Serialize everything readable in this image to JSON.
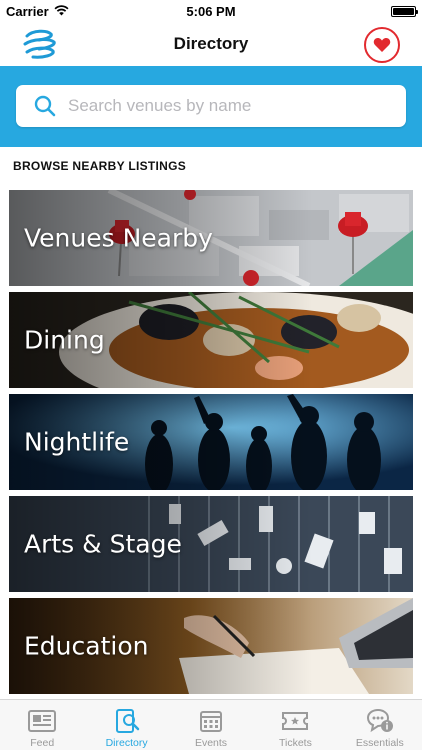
{
  "status_bar": {
    "carrier": "Carrier",
    "time": "5:06 PM",
    "battery_level": 1.0
  },
  "nav": {
    "title": "Directory",
    "logo_icon": "app-logo-icon",
    "favorite_icon": "heart-icon"
  },
  "search": {
    "placeholder": "Search venues by name",
    "value": ""
  },
  "section": {
    "title": "BROWSE NEARBY LISTINGS"
  },
  "tiles": [
    {
      "label": "Venues Nearby"
    },
    {
      "label": "Dining"
    },
    {
      "label": "Nightlife"
    },
    {
      "label": "Arts & Stage"
    },
    {
      "label": "Education"
    }
  ],
  "tabs": [
    {
      "label": "Feed",
      "icon": "newspaper-icon",
      "active": false
    },
    {
      "label": "Directory",
      "icon": "directory-icon",
      "active": true
    },
    {
      "label": "Events",
      "icon": "calendar-icon",
      "active": false
    },
    {
      "label": "Tickets",
      "icon": "ticket-icon",
      "active": false
    },
    {
      "label": "Essentials",
      "icon": "info-chat-icon",
      "active": false
    }
  ],
  "colors": {
    "accent": "#27a8e0",
    "heart": "#e22a2f",
    "tab_inactive": "#9a9a9a"
  }
}
